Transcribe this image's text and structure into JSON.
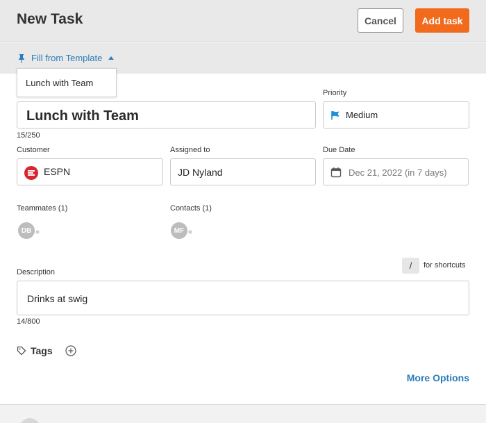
{
  "header": {
    "title": "New Task",
    "cancel_label": "Cancel",
    "add_label": "Add task",
    "accent_color": "#f26a1b"
  },
  "template": {
    "toggle_label": "Fill from Template",
    "items": [
      {
        "label": "Lunch with Team"
      }
    ]
  },
  "form": {
    "title_value": "Lunch with Team",
    "title_counter": "15/250",
    "priority_label": "Priority",
    "priority_value": "Medium",
    "customer_label": "Customer",
    "customer_value": "ESPN",
    "assigned_label": "Assigned to",
    "assigned_value": "JD Nyland",
    "due_label": "Due Date",
    "due_value": "Dec 21, 2022 (in 7 days)",
    "teammates_label": "Teammates (1)",
    "teammates": [
      {
        "initials": "DB"
      }
    ],
    "contacts_label": "Contacts (1)",
    "contacts": [
      {
        "initials": "MF"
      }
    ],
    "shortcut_key": "/",
    "shortcut_text": "for shortcuts",
    "description_label": "Description",
    "description_value": "Drinks at swig",
    "description_counter": "14/800",
    "tags_label": "Tags",
    "more_options_label": "More Options"
  }
}
